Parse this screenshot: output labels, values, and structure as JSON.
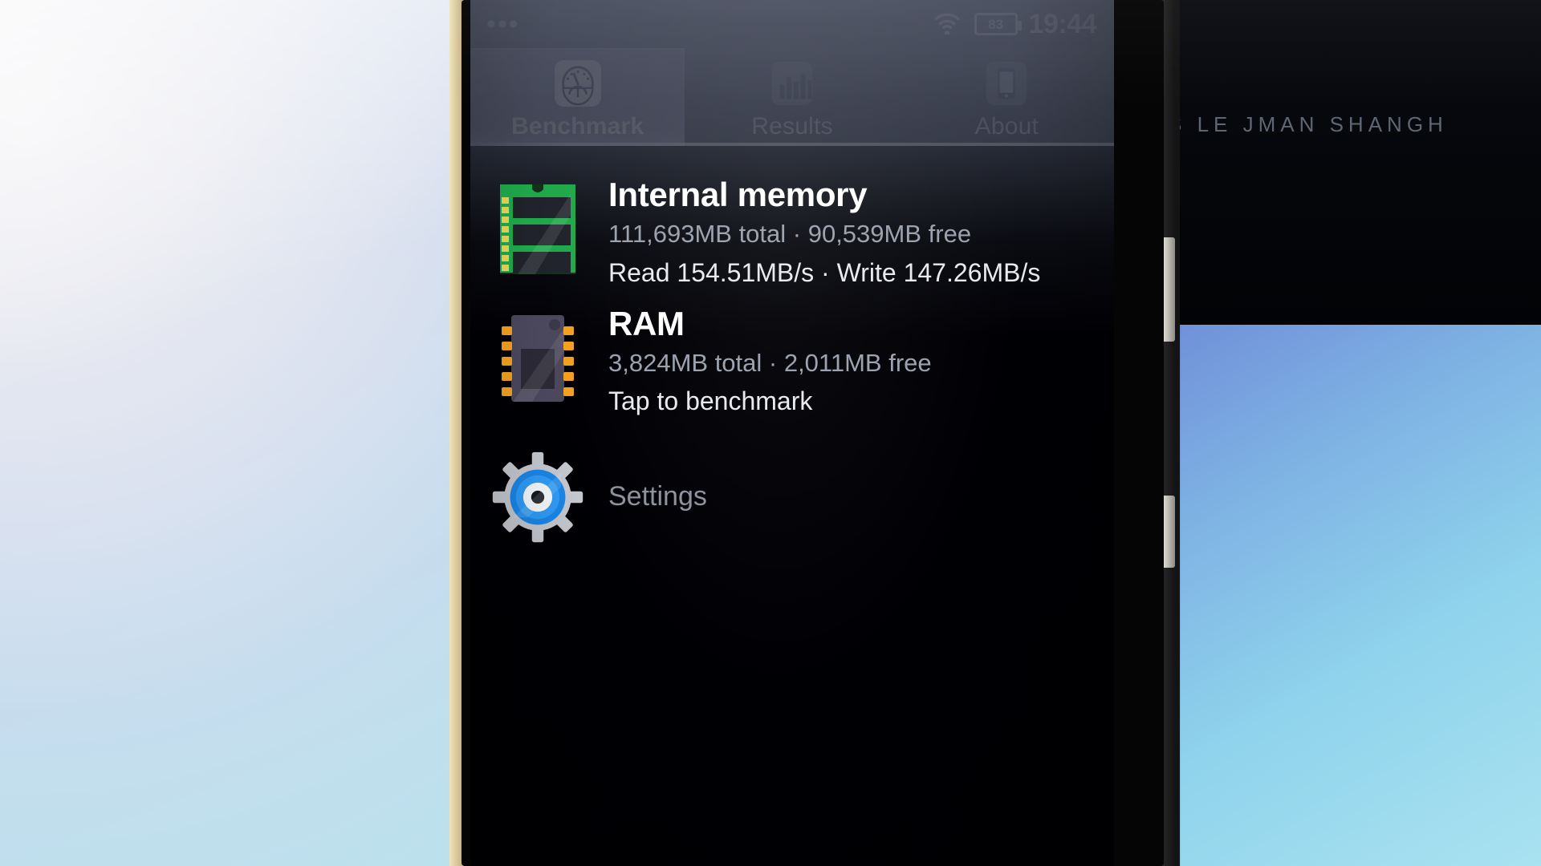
{
  "status_bar": {
    "notification_dots": "•••",
    "wifi_icon": "wifi-icon",
    "battery_level": "83",
    "time": "19:44"
  },
  "tabs": [
    {
      "label": "Benchmark",
      "icon": "speedometer-icon",
      "active": true
    },
    {
      "label": "Results",
      "icon": "bar-chart-icon",
      "active": false
    },
    {
      "label": "About",
      "icon": "phone-icon",
      "active": false
    }
  ],
  "benchmark_items": [
    {
      "title": "Internal memory",
      "capacity": "111,693MB total · 90,539MB free",
      "action": "Read 154.51MB/s · Write 147.26MB/s",
      "icon": "memory-module-icon"
    },
    {
      "title": "RAM",
      "capacity": "3,824MB total · 2,011MB free",
      "action": "Tap to benchmark",
      "icon": "ram-chip-icon"
    }
  ],
  "settings": {
    "label": "Settings",
    "icon": "gear-icon"
  },
  "background": {
    "monitor_text": "S LE JMAN   SHANGH"
  },
  "colors": {
    "status_bar_bg": "#41465a",
    "tab_active_bg": "#8e8ea8",
    "screen_bg": "#000004",
    "title_text": "#ffffff",
    "sub_text": "#9aa0ad",
    "memory_icon_green": "#1fa84a",
    "gear_blue": "#1a86e8"
  }
}
